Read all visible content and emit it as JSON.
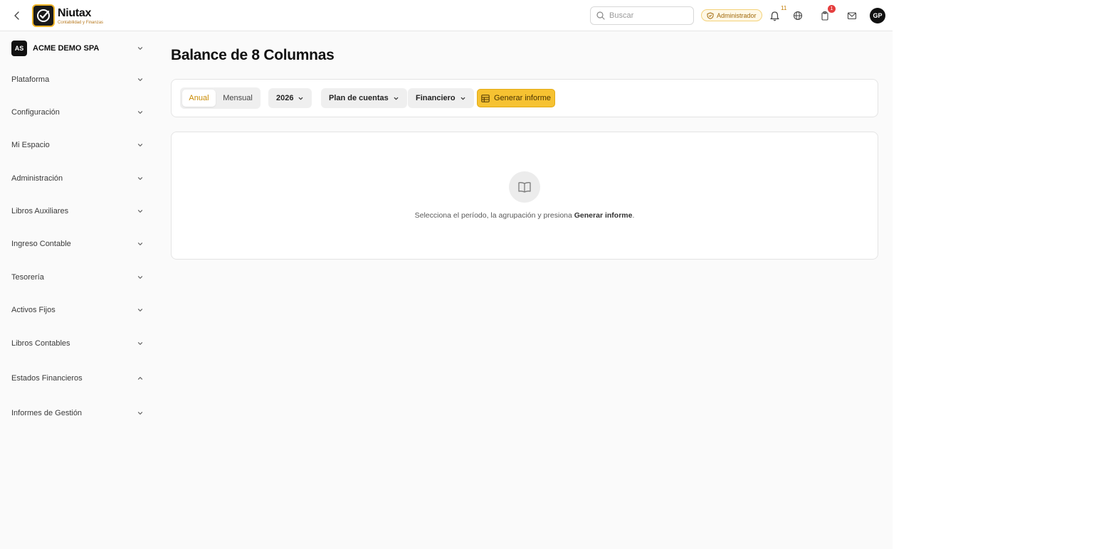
{
  "header": {
    "brand_name": "Niutax",
    "brand_sub": "Contabilidad y Finanzas",
    "search_placeholder": "Buscar",
    "role_badge": "Administrador",
    "notifications_count": "11",
    "tasks_count": "1",
    "user_initials": "GP"
  },
  "sidebar": {
    "company_initials": "AS",
    "company_name": "ACME DEMO SPA",
    "items": [
      {
        "label": "Plataforma",
        "expanded": false
      },
      {
        "label": "Configuración",
        "expanded": false
      },
      {
        "label": "Mi Espacio",
        "expanded": false
      },
      {
        "label": "Administración",
        "expanded": false
      },
      {
        "label": "Libros Auxiliares",
        "expanded": false
      },
      {
        "label": "Ingreso Contable",
        "expanded": false
      },
      {
        "label": "Tesorería",
        "expanded": false
      },
      {
        "label": "Activos Fijos",
        "expanded": false
      },
      {
        "label": "Libros Contables",
        "expanded": false
      },
      {
        "label": "Estados Financieros",
        "expanded": true
      },
      {
        "label": "Informes de Gestión",
        "expanded": false
      }
    ]
  },
  "main": {
    "title": "Balance de 8 Columnas",
    "toolbar": {
      "period_tabs": [
        {
          "label": "Anual",
          "active": true
        },
        {
          "label": "Mensual",
          "active": false
        }
      ],
      "year": "2026",
      "grouping": "Plan de cuentas",
      "view": "Financiero",
      "generate_label": "Generar informe"
    },
    "empty_state": {
      "text_before": "Selecciona el período, la agrupación y presiona ",
      "text_strong": "Generar informe",
      "text_after": "."
    }
  },
  "colors": {
    "accent": "#f6c232",
    "accent_text": "#c98a00",
    "badge_red": "#e53e3e"
  }
}
